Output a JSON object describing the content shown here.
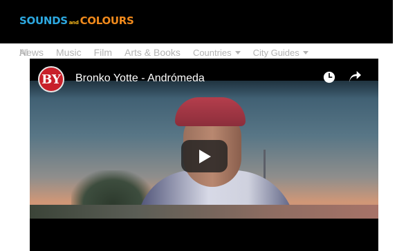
{
  "site": {
    "logo_part1": "SOUNDS",
    "logo_and": "and",
    "logo_part2": "COLOURS",
    "colors": {
      "header_bg": "#000000",
      "logo_blue": "#2da8e0",
      "logo_orange": "#f18a1c"
    }
  },
  "nav": {
    "items": [
      {
        "label": "News",
        "has_caret": false
      },
      {
        "label": "Music",
        "has_caret": false
      },
      {
        "label": "Film",
        "has_caret": false
      },
      {
        "label": "Arts & Books",
        "has_caret": false
      },
      {
        "label": "Countries",
        "has_caret": true
      },
      {
        "label": "City Guides",
        "has_caret": true
      }
    ],
    "overflow_label": "Al"
  },
  "video": {
    "title": "Bronko Yotte - Andrómeda",
    "channel_initials": "BY",
    "icons": {
      "watch_later": "clock-icon",
      "share": "share-arrow-icon",
      "play": "play-icon"
    }
  }
}
